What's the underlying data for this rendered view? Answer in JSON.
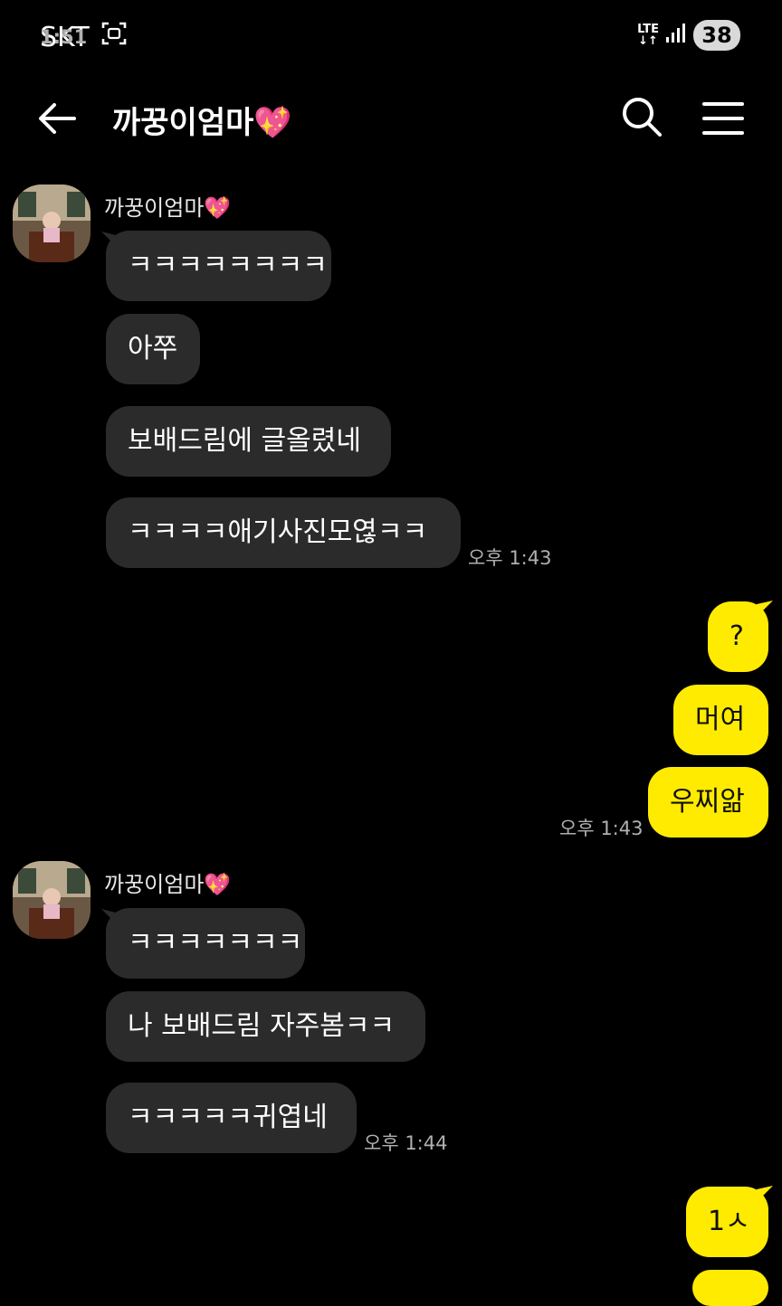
{
  "status": {
    "carrier": "SKT",
    "time": "1:51",
    "network": "LTE",
    "battery": "38"
  },
  "header": {
    "title": "까꿍이엄마💖"
  },
  "groups": [
    {
      "sender": "까꿍이엄마💖",
      "messages": [
        "ㅋㅋㅋㅋㅋㅋㅋㅋ",
        "아쭈",
        "보배드림에 글올렸네",
        "ㅋㅋㅋㅋ애기사진모엲ㅋㅋ"
      ],
      "time": "오후 1:43"
    },
    {
      "sender": "me",
      "messages": [
        "?",
        "머여",
        "우찌앎"
      ],
      "time": "오후 1:43"
    },
    {
      "sender": "까꿍이엄마💖",
      "messages": [
        "ㅋㅋㅋㅋㅋㅋㅋ",
        "나 보배드림 자주봄ㅋㅋ",
        "ㅋㅋㅋㅋㅋ귀엽네"
      ],
      "time": "오후 1:44"
    },
    {
      "sender": "me",
      "messages": [
        "1ㅅ"
      ],
      "time": ""
    }
  ],
  "colors": {
    "background": "#000000",
    "incoming_bubble": "#2b2b2b",
    "outgoing_bubble": "#ffeb00"
  }
}
